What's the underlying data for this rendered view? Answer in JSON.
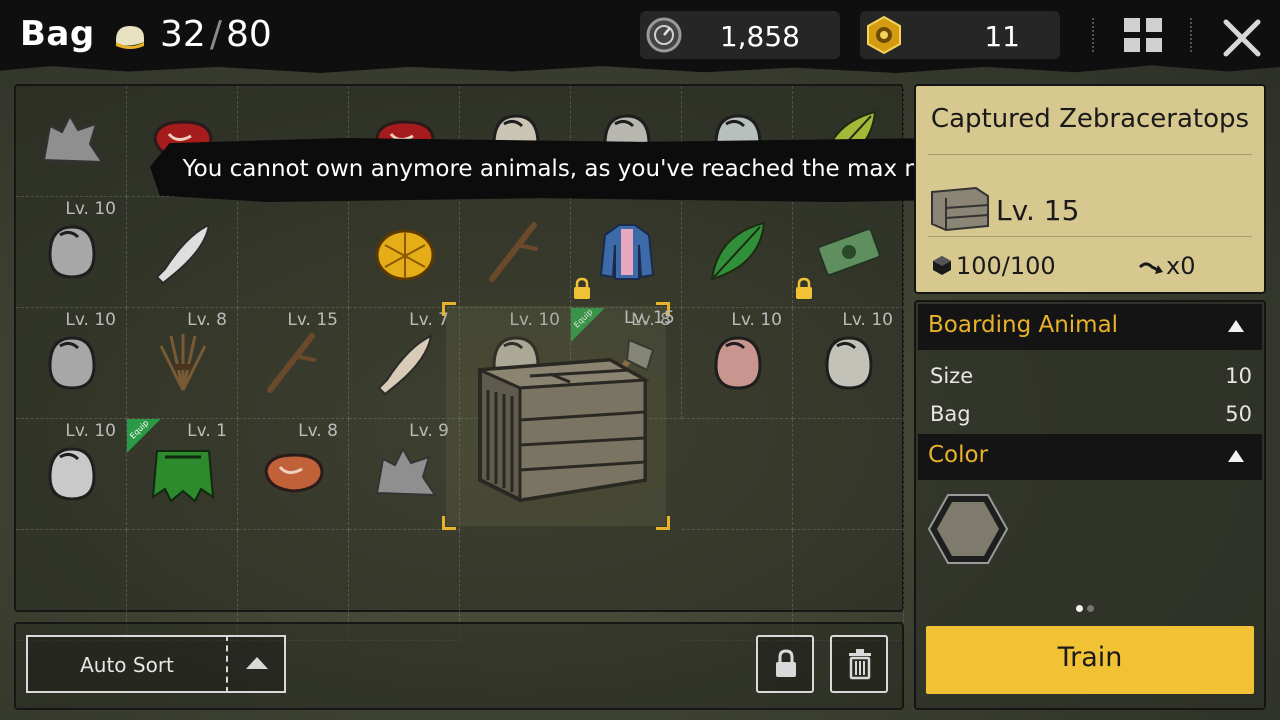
{
  "header": {
    "title": "Bag",
    "capacity_current": "32",
    "capacity_separator": "/",
    "capacity_max": "80",
    "currency_1": {
      "icon": "coin-icon",
      "value": "1,858"
    },
    "currency_2": {
      "icon": "gear-token-icon",
      "value": "11"
    }
  },
  "toast": {
    "message": "You cannot own anymore animals, as you've reached the max number allowed."
  },
  "inventory": {
    "cells": [
      {
        "row": 0,
        "col": 0,
        "level": "",
        "icon": "leather-hide-icon",
        "color": "#8f8f8f"
      },
      {
        "row": 0,
        "col": 1,
        "level": "",
        "icon": "raw-meat-icon",
        "color": "#a61c1c"
      },
      {
        "row": 0,
        "col": 2,
        "level": "",
        "icon": "",
        "color": ""
      },
      {
        "row": 0,
        "col": 3,
        "level": "",
        "icon": "raw-meat-icon",
        "color": "#a61c1c"
      },
      {
        "row": 0,
        "col": 4,
        "level": "",
        "icon": "egg-icon",
        "color": "#c9c4b4"
      },
      {
        "row": 0,
        "col": 5,
        "level": "",
        "icon": "egg-icon",
        "color": "#b8b8b0"
      },
      {
        "row": 0,
        "col": 6,
        "level": "",
        "icon": "egg-icon",
        "color": "#b7c0bc"
      },
      {
        "row": 0,
        "col": 7,
        "level": "",
        "icon": "leaf-icon",
        "color": "#a4b83a"
      },
      {
        "row": 1,
        "col": 0,
        "level": "Lv. 10",
        "icon": "egg-icon",
        "color": "#a7a7a7"
      },
      {
        "row": 1,
        "col": 1,
        "level": "",
        "icon": "bone-club-icon",
        "color": "#dedede"
      },
      {
        "row": 1,
        "col": 2,
        "level": "",
        "icon": "",
        "color": ""
      },
      {
        "row": 1,
        "col": 3,
        "level": "",
        "icon": "gold-shell-icon",
        "color": "#e5ad18"
      },
      {
        "row": 1,
        "col": 4,
        "level": "",
        "icon": "stick-icon",
        "color": "#6b4a2c"
      },
      {
        "row": 1,
        "col": 5,
        "level": "",
        "icon": "jacket-icon",
        "color": "#3d6aa8",
        "locked": true
      },
      {
        "row": 1,
        "col": 6,
        "level": "",
        "icon": "leaf-icon",
        "color": "#2f8f3a"
      },
      {
        "row": 1,
        "col": 7,
        "level": "",
        "icon": "cash-bundle-icon",
        "color": "#5f8f5f",
        "locked": true
      },
      {
        "row": 2,
        "col": 0,
        "level": "Lv. 10",
        "icon": "egg-icon",
        "color": "#a7a7a7"
      },
      {
        "row": 2,
        "col": 1,
        "level": "Lv. 8",
        "icon": "grass-bundle-icon",
        "color": "#7a5a34"
      },
      {
        "row": 2,
        "col": 2,
        "level": "Lv. 15",
        "icon": "stick-icon",
        "color": "#6b4a2c"
      },
      {
        "row": 2,
        "col": 3,
        "level": "Lv. 7",
        "icon": "bone-club-icon",
        "color": "#d8ccb8"
      },
      {
        "row": 2,
        "col": 4,
        "level": "Lv. 10",
        "icon": "egg-icon",
        "color": "#b8b4a8"
      },
      {
        "row": 2,
        "col": 5,
        "level": "Lv. 8",
        "icon": "stone-axe-icon",
        "color": "#8a6a4a",
        "equip": true
      },
      {
        "row": 2,
        "col": 6,
        "level": "Lv. 10",
        "icon": "egg-icon",
        "color": "#c9958f"
      },
      {
        "row": 2,
        "col": 7,
        "level": "Lv. 10",
        "icon": "egg-icon",
        "color": "#c2c2b8"
      },
      {
        "row": 3,
        "col": 0,
        "level": "Lv. 10",
        "icon": "egg-icon",
        "color": "#c9c9c9"
      },
      {
        "row": 3,
        "col": 1,
        "level": "Lv. 1",
        "icon": "leaf-skirt-icon",
        "color": "#2d8a2d",
        "equip": true
      },
      {
        "row": 3,
        "col": 2,
        "level": "Lv. 8",
        "icon": "cooked-meat-icon",
        "color": "#c1613a"
      },
      {
        "row": 3,
        "col": 3,
        "level": "Lv. 9",
        "icon": "leather-hide-icon",
        "color": "#8f8f8f"
      }
    ],
    "equip_tag": "Equip",
    "selected": {
      "level": "Lv. 15",
      "icon": "wooden-crate-icon"
    }
  },
  "bottom_bar": {
    "auto_sort_label": "Auto Sort",
    "lock_icon": "lock-icon",
    "trash_icon": "trash-icon"
  },
  "detail": {
    "title": "Captured Zebraceratops",
    "level": "Lv. 15",
    "capacity": "100/100",
    "multiplier": "x0",
    "sections": {
      "boarding_title": "Boarding Animal",
      "size_label": "Size",
      "size_value": "10",
      "bag_label": "Bag",
      "bag_value": "50",
      "color_title": "Color"
    },
    "color_swatch": "#7e7a6c",
    "train_label": "Train"
  },
  "colors": {
    "accent_yellow": "#f1c233",
    "section_title": "#e8b22a",
    "card_bg": "#d7c88f",
    "equip_green": "#2a9a46"
  }
}
